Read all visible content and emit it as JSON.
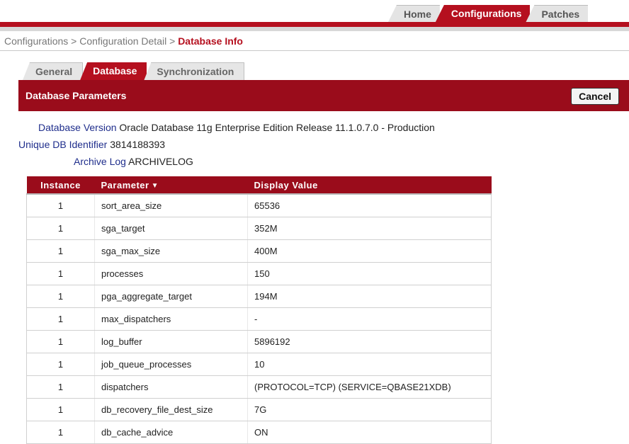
{
  "top_tabs": [
    {
      "label": "Home",
      "active": false
    },
    {
      "label": "Configurations",
      "active": true
    },
    {
      "label": "Patches",
      "active": false
    }
  ],
  "breadcrumb": {
    "items": [
      "Configurations",
      "Configuration Detail"
    ],
    "separator": ">",
    "current": "Database Info"
  },
  "sub_tabs": [
    {
      "label": "General",
      "active": false
    },
    {
      "label": "Database",
      "active": true
    },
    {
      "label": "Synchronization",
      "active": false
    }
  ],
  "panel": {
    "title": "Database Parameters",
    "cancel_label": "Cancel"
  },
  "info": {
    "version_label": "Database Version",
    "version_value": "Oracle Database 11g Enterprise Edition Release 11.1.0.7.0 - Production",
    "dbid_label": "Unique DB Identifier",
    "dbid_value": "3814188393",
    "archive_label": "Archive Log",
    "archive_value": "ARCHIVELOG"
  },
  "table": {
    "columns": [
      "Instance",
      "Parameter",
      "Display Value"
    ],
    "sorted_column_icon": "sort-desc-icon",
    "rows": [
      {
        "instance": "1",
        "parameter": "sort_area_size",
        "value": "65536"
      },
      {
        "instance": "1",
        "parameter": "sga_target",
        "value": "352M"
      },
      {
        "instance": "1",
        "parameter": "sga_max_size",
        "value": "400M"
      },
      {
        "instance": "1",
        "parameter": "processes",
        "value": "150"
      },
      {
        "instance": "1",
        "parameter": "pga_aggregate_target",
        "value": "194M"
      },
      {
        "instance": "1",
        "parameter": "max_dispatchers",
        "value": "-"
      },
      {
        "instance": "1",
        "parameter": "log_buffer",
        "value": "5896192"
      },
      {
        "instance": "1",
        "parameter": "job_queue_processes",
        "value": "10"
      },
      {
        "instance": "1",
        "parameter": "dispatchers",
        "value": "(PROTOCOL=TCP) (SERVICE=QBASE21XDB)"
      },
      {
        "instance": "1",
        "parameter": "db_recovery_file_dest_size",
        "value": "7G"
      },
      {
        "instance": "1",
        "parameter": "db_cache_advice",
        "value": "ON"
      }
    ]
  },
  "colors": {
    "brand_red": "#b5101f",
    "header_red": "#9a0c1b",
    "label_blue": "#1f2e8c"
  }
}
